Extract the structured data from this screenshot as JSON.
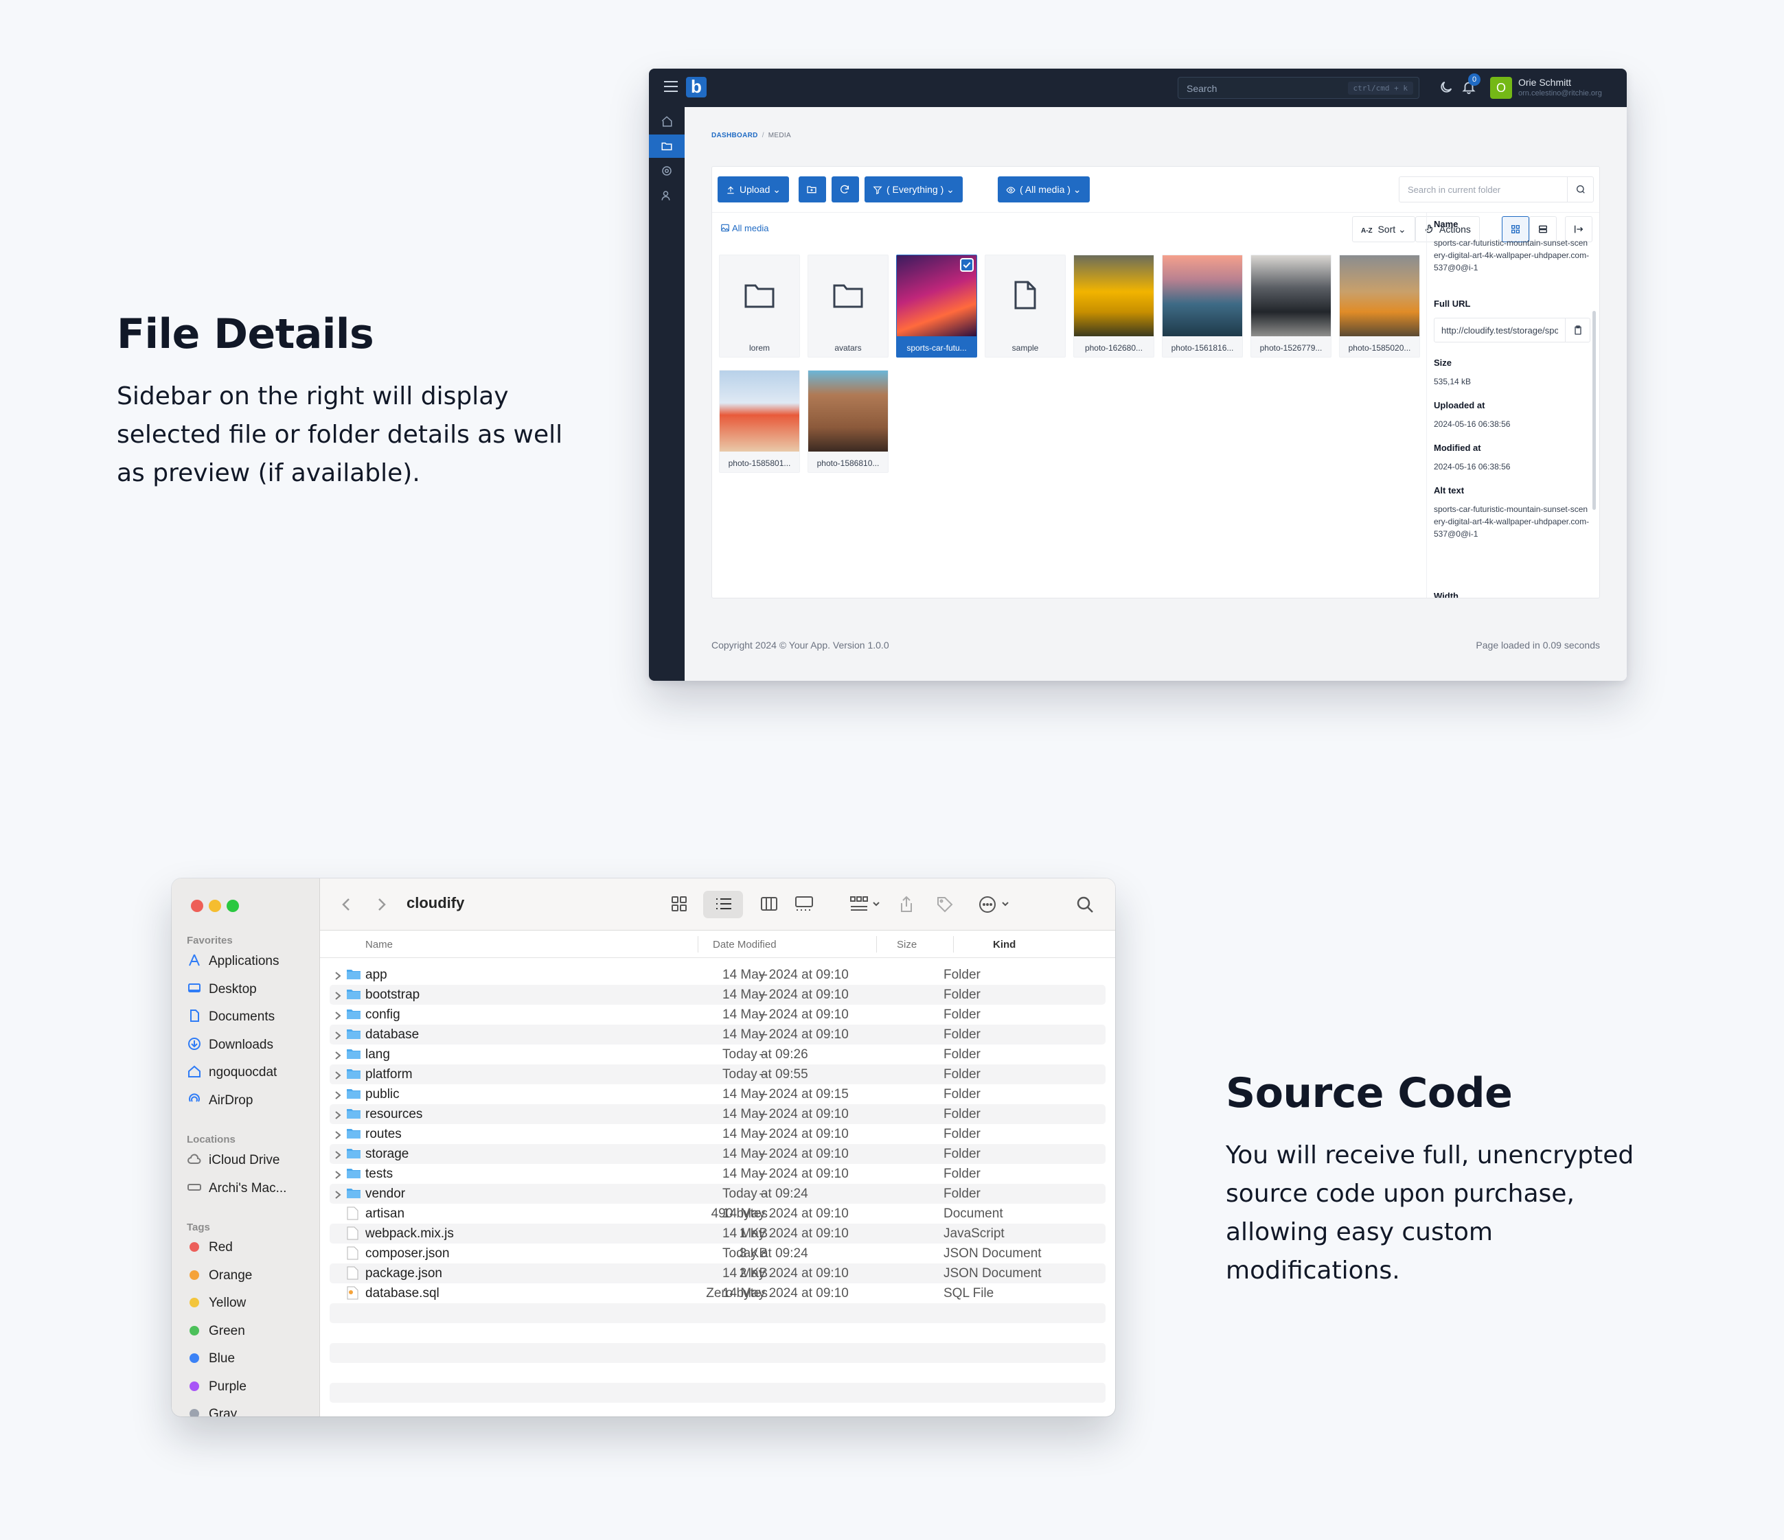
{
  "promo_file": {
    "title": "File Details",
    "body": "Sidebar on the right will display selected file or folder details as well as preview (if available)."
  },
  "promo_code": {
    "title": "Source Code",
    "body": "You will receive full, unencrypted source code upon purchase, allowing easy custom modifications."
  },
  "admin": {
    "logo": "b",
    "search_placeholder": "Search",
    "search_shortcut": "ctrl/cmd + k",
    "notification_count": "0",
    "user": {
      "initial": "O",
      "name": "Orie Schmitt",
      "email": "orn.celestino@ritchie.org"
    },
    "breadcrumb": [
      "DASHBOARD",
      "MEDIA"
    ],
    "toolbar": {
      "upload": "Upload",
      "filter": "( Everything )",
      "visibility": "( All media )",
      "folder_search_placeholder": "Search in current folder"
    },
    "all_media": "All media",
    "sort_label": "Sort",
    "sort_prefix": "A-Z",
    "actions_label": "Actions",
    "items": [
      {
        "label": "lorem",
        "kind": "folder"
      },
      {
        "label": "avatars",
        "kind": "folder"
      },
      {
        "label": "sports-car-futu...",
        "kind": "image",
        "selected": true
      },
      {
        "label": "sample",
        "kind": "file"
      },
      {
        "label": "photo-162680...",
        "kind": "image"
      },
      {
        "label": "photo-1561816...",
        "kind": "image"
      },
      {
        "label": "photo-1526779...",
        "kind": "image"
      },
      {
        "label": "photo-1585020...",
        "kind": "image"
      },
      {
        "label": "photo-1585801...",
        "kind": "image"
      },
      {
        "label": "photo-1586810...",
        "kind": "image"
      }
    ],
    "details": {
      "name_label": "Name",
      "name": "sports-car-futuristic-mountain-sunset-scenery-digital-art-4k-wallpaper-uhdpaper.com-537@0@i-1",
      "url_label": "Full URL",
      "url": "http://cloudify.test/storage/sports-car",
      "size_label": "Size",
      "size": "535,14 kB",
      "uploaded_label": "Uploaded at",
      "uploaded": "2024-05-16 06:38:56",
      "modified_label": "Modified at",
      "modified": "2024-05-16 06:38:56",
      "alt_label": "Alt text",
      "alt": "sports-car-futuristic-mountain-sunset-scenery-digital-art-4k-wallpaper-uhdpaper.com-537@0@i-1",
      "width_label": "Width"
    },
    "footer_left": "Copyright 2024 © Your App. Version 1.0.0",
    "footer_right": "Page loaded in 0.09 seconds"
  },
  "finder": {
    "title": "cloudify",
    "sidebar": {
      "favorites_label": "Favorites",
      "favorites": [
        "Applications",
        "Desktop",
        "Documents",
        "Downloads",
        "ngoquocdat",
        "AirDrop"
      ],
      "locations_label": "Locations",
      "locations": [
        "iCloud Drive",
        "Archi's Mac..."
      ],
      "tags_label": "Tags",
      "tags": [
        {
          "name": "Red",
          "color": "#ec5f5a"
        },
        {
          "name": "Orange",
          "color": "#f5a33a"
        },
        {
          "name": "Yellow",
          "color": "#f3c53c"
        },
        {
          "name": "Green",
          "color": "#4cc05a"
        },
        {
          "name": "Blue",
          "color": "#3b82f6"
        },
        {
          "name": "Purple",
          "color": "#a855f7"
        },
        {
          "name": "Gray",
          "color": "#9ca3af"
        }
      ]
    },
    "columns": {
      "name": "Name",
      "date": "Date Modified",
      "size": "Size",
      "kind": "Kind"
    },
    "rows": [
      {
        "name": "app",
        "date": "14 May 2024 at 09:10",
        "size": "--",
        "kind": "Folder",
        "folder": true
      },
      {
        "name": "bootstrap",
        "date": "14 May 2024 at 09:10",
        "size": "--",
        "kind": "Folder",
        "folder": true
      },
      {
        "name": "config",
        "date": "14 May 2024 at 09:10",
        "size": "--",
        "kind": "Folder",
        "folder": true
      },
      {
        "name": "database",
        "date": "14 May 2024 at 09:10",
        "size": "--",
        "kind": "Folder",
        "folder": true
      },
      {
        "name": "lang",
        "date": "Today at 09:26",
        "size": "--",
        "kind": "Folder",
        "folder": true
      },
      {
        "name": "platform",
        "date": "Today at 09:55",
        "size": "--",
        "kind": "Folder",
        "folder": true
      },
      {
        "name": "public",
        "date": "14 May 2024 at 09:15",
        "size": "--",
        "kind": "Folder",
        "folder": true
      },
      {
        "name": "resources",
        "date": "14 May 2024 at 09:10",
        "size": "--",
        "kind": "Folder",
        "folder": true
      },
      {
        "name": "routes",
        "date": "14 May 2024 at 09:10",
        "size": "--",
        "kind": "Folder",
        "folder": true
      },
      {
        "name": "storage",
        "date": "14 May 2024 at 09:10",
        "size": "--",
        "kind": "Folder",
        "folder": true
      },
      {
        "name": "tests",
        "date": "14 May 2024 at 09:10",
        "size": "--",
        "kind": "Folder",
        "folder": true
      },
      {
        "name": "vendor",
        "date": "Today at 09:24",
        "size": "--",
        "kind": "Folder",
        "folder": true
      },
      {
        "name": "artisan",
        "date": "14 May 2024 at 09:10",
        "size": "490 bytes",
        "kind": "Document",
        "folder": false
      },
      {
        "name": "webpack.mix.js",
        "date": "14 May 2024 at 09:10",
        "size": "1 KB",
        "kind": "JavaScript",
        "folder": false
      },
      {
        "name": "composer.json",
        "date": "Today at 09:24",
        "size": "3 KB",
        "kind": "JSON Document",
        "folder": false
      },
      {
        "name": "package.json",
        "date": "14 May 2024 at 09:10",
        "size": "2 KB",
        "kind": "JSON Document",
        "folder": false
      },
      {
        "name": "database.sql",
        "date": "14 May 2024 at 09:10",
        "size": "Zero bytes",
        "kind": "SQL File",
        "folder": false
      }
    ]
  }
}
